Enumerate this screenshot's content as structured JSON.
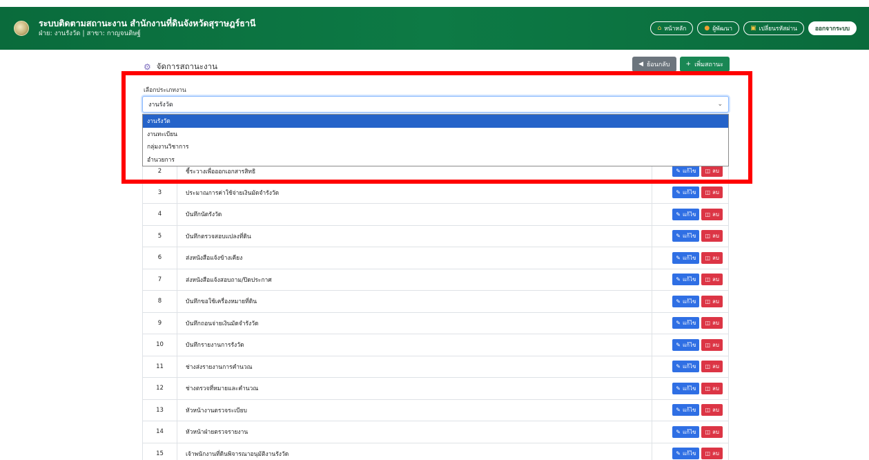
{
  "header": {
    "title": "ระบบติดตามสถานะงาน สำนักงานที่ดินจังหวัดสุราษฎร์ธานี",
    "subtitle": "ฝ่าย: งานรังวัด | สาขา: กาญจนดิษฐ์",
    "nav": {
      "home_label": "หน้าหลัก",
      "developer_label": "ผู้พัฒนา",
      "change_password_label": "เปลี่ยนรหัสผ่าน",
      "logout_label": "ออกจากระบบ"
    }
  },
  "page": {
    "title": "จัดการสถานะงาน",
    "back_label": "ย้อนกลับ",
    "add_label": "เพิ่มสถานะ"
  },
  "work_type": {
    "label": "เลือกประเภทงาน",
    "selected": "งานรังวัด",
    "options": [
      "งานรังวัด",
      "งานทะเบียน",
      "กลุ่มงานวิชาการ",
      "อำนวยการ"
    ]
  },
  "row_actions": {
    "edit_label": "แก้ไข",
    "delete_label": "ลบ"
  },
  "rows": [
    {
      "no": "2",
      "name": "ชี้ระวางเพื่อออกเอกสารสิทธิ"
    },
    {
      "no": "3",
      "name": "ประมาณการค่าใช้จ่ายเงินมัดจำรังวัด"
    },
    {
      "no": "4",
      "name": "บันทึกนัดรังวัด"
    },
    {
      "no": "5",
      "name": "บันทึกตรวจสอบแปลงที่ดิน"
    },
    {
      "no": "6",
      "name": "ส่งหนังสือแจ้งข้างเคียง"
    },
    {
      "no": "7",
      "name": "ส่งหนังสือแจ้งสอบถาม/ปิดประกาศ"
    },
    {
      "no": "8",
      "name": "บันทึกขอใช้เครื่องหมายที่ดิน"
    },
    {
      "no": "9",
      "name": "บันทึกถอนจ่ายเงินมัดจำรังวัด"
    },
    {
      "no": "10",
      "name": "บันทึกรายงานการรังวัด"
    },
    {
      "no": "11",
      "name": "ช่างส่งรายงานการคำนวณ"
    },
    {
      "no": "12",
      "name": "ช่างตรวจที่หมายและคำนวณ"
    },
    {
      "no": "13",
      "name": "หัวหน้างานตรวจระเบียบ"
    },
    {
      "no": "14",
      "name": "หัวหน้าฝ่ายตรวจรายงาน"
    },
    {
      "no": "15",
      "name": "เจ้าพนักงานที่ดินพิจารณาอนุมัติงานรังวัด"
    }
  ],
  "icons": {
    "logo": "emblem-logo",
    "home": "house-icon",
    "developer": "user-icon",
    "password": "gift-key-icon",
    "title": "gear-icon",
    "back": "arrow-left-icon",
    "add": "plus-icon",
    "edit": "pencil-icon",
    "delete": "trash-icon",
    "select": "chevron-down-icon"
  },
  "colors": {
    "header_green": "#0d7a45",
    "primary_blue": "#2f6fe4",
    "danger_red": "#dc3545",
    "success_green": "#198754",
    "highlight_red": "#ff0000"
  }
}
